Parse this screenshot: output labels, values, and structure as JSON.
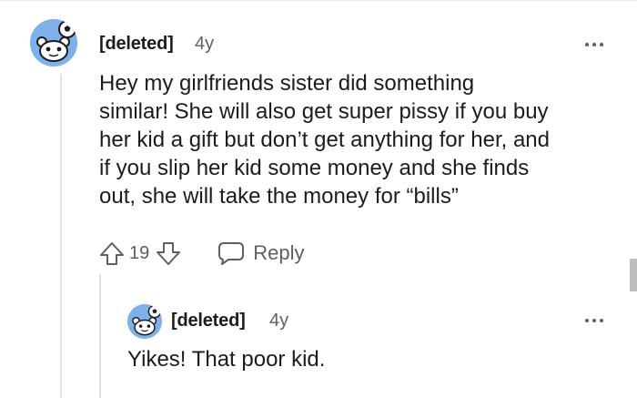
{
  "comment": {
    "author": "[deleted]",
    "age": "4y",
    "body_lines": [
      "Hey my girlfriends sister did something",
      "similar! She will also get super pissy if you buy",
      "her kid a gift but don’t get anything for her, and",
      "if you slip her kid some money and she finds",
      "out, she will take the money for “bills”"
    ],
    "score": "19",
    "reply_label": "Reply",
    "avatar_icon": "reddit-snoo-avatar-icon",
    "more_icon": "more-options-icon",
    "upvote_icon": "upvote-arrow-icon",
    "downvote_icon": "downvote-arrow-icon",
    "reply_icon": "comment-bubble-icon"
  },
  "reply": {
    "author": "[deleted]",
    "age": "4y",
    "body": "Yikes! That poor kid.",
    "avatar_icon": "reddit-snoo-avatar-icon",
    "more_icon": "more-options-icon"
  },
  "colors": {
    "avatar_bg": "#7eb0ec",
    "text_primary": "#1c1c1c",
    "text_secondary": "#5f5f5f",
    "thread_line": "#e4e4e4"
  }
}
